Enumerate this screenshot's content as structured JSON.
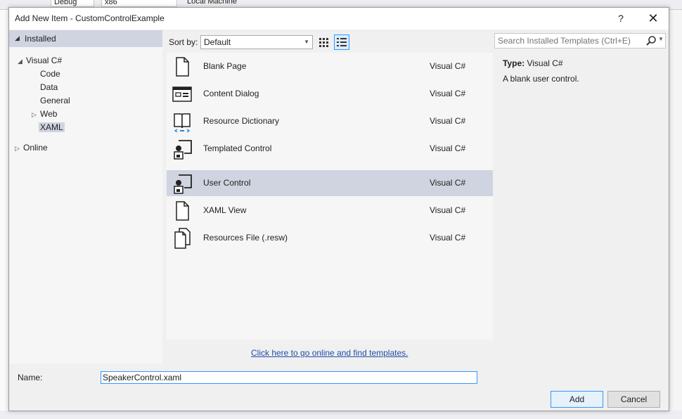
{
  "background": {
    "config": "Debug",
    "platform": "x86",
    "target": "Local Machine"
  },
  "dialog": {
    "title": "Add New Item - CustomControlExample",
    "help_label": "?",
    "close_label": "✕"
  },
  "tree": {
    "installed": "Installed",
    "visual_csharp": "Visual C#",
    "code": "Code",
    "data": "Data",
    "general": "General",
    "web": "Web",
    "xaml": "XAML",
    "online": "Online"
  },
  "sort": {
    "label": "Sort by:",
    "value": "Default"
  },
  "templates": [
    {
      "name": "Blank Page",
      "lang": "Visual C#",
      "icon": "page-icon"
    },
    {
      "name": "Content Dialog",
      "lang": "Visual C#",
      "icon": "dialog-icon"
    },
    {
      "name": "Resource Dictionary",
      "lang": "Visual C#",
      "icon": "book-icon"
    },
    {
      "name": "Templated Control",
      "lang": "Visual C#",
      "icon": "control-icon"
    },
    {
      "name": "User Control",
      "lang": "Visual C#",
      "icon": "control-icon"
    },
    {
      "name": "XAML View",
      "lang": "Visual C#",
      "icon": "page-icon"
    },
    {
      "name": "Resources File (.resw)",
      "lang": "Visual C#",
      "icon": "resources-icon"
    }
  ],
  "search": {
    "placeholder": "Search Installed Templates (Ctrl+E)"
  },
  "info": {
    "type_label": "Type:",
    "type_value": "Visual C#",
    "description": "A blank user control."
  },
  "online_link": "Click here to go online and find templates.",
  "name_field": {
    "label": "Name:",
    "value": "SpeakerControl.xaml"
  },
  "buttons": {
    "add": "Add",
    "cancel": "Cancel"
  },
  "colors": {
    "selection": "#cfd4e0",
    "accent": "#3399ff",
    "link": "#1e4ca6"
  }
}
